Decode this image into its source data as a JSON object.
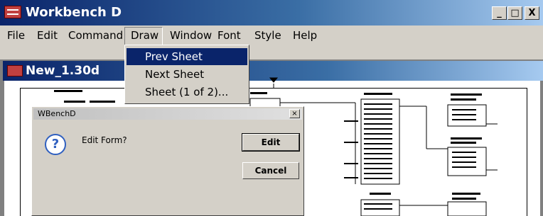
{
  "window": {
    "title": "Workbench D",
    "controls": {
      "minimize": "_",
      "maximize": "□",
      "close": "X"
    }
  },
  "menubar": {
    "items": [
      "File",
      "Edit",
      "Command",
      "Draw",
      "Window",
      "Font",
      "Style",
      "Help"
    ],
    "active": "Draw"
  },
  "draw_menu": {
    "items": [
      "Prev Sheet",
      "Next Sheet",
      "Sheet (1 of 2)..."
    ],
    "highlighted": "Prev Sheet"
  },
  "child_window": {
    "title": "New_1.30d"
  },
  "dialog": {
    "title": "WBenchD",
    "close": "×",
    "message": "Edit Form?",
    "buttons": {
      "edit": "Edit",
      "cancel": "Cancel"
    },
    "icon": "question-icon"
  },
  "colors": {
    "titlebar": "#0a246a",
    "face": "#d4d0c8",
    "selection": "#0a246a"
  }
}
